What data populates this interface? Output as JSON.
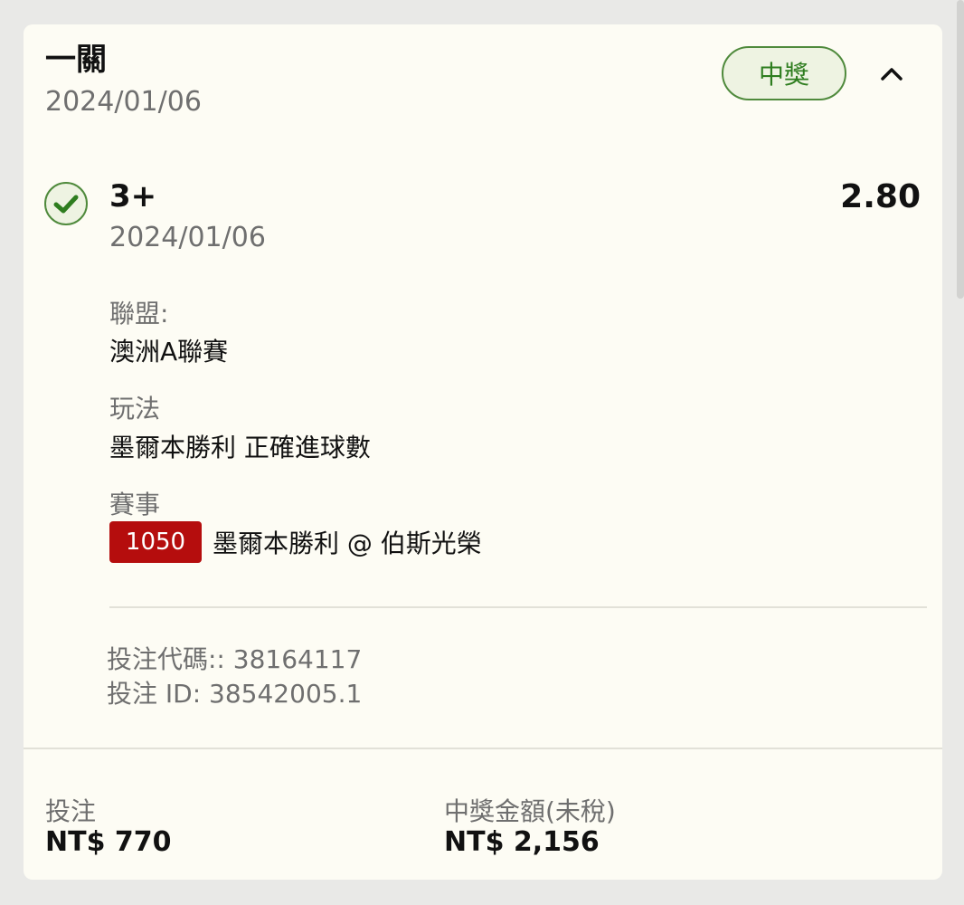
{
  "bet": {
    "type": "一關",
    "date": "2024/01/06",
    "status": "中獎"
  },
  "selection": {
    "name": "3+",
    "date": "2024/01/06",
    "odds": "2.80",
    "league_label": "聯盟:",
    "league": "澳洲A聯賽",
    "play_label": "玩法",
    "play": "墨爾本勝利 正確進球數",
    "event_label": "賽事",
    "event_id": "1050",
    "event": "墨爾本勝利 @ 伯斯光榮"
  },
  "codes": {
    "bet_code": "投注代碼:: 38164117",
    "bet_id": "投注 ID: 38542005.1"
  },
  "footer": {
    "stake_label": "投注",
    "stake": "NT$ 770",
    "payout_label": "中獎金額(未稅)",
    "payout": "NT$ 2,156"
  },
  "colors": {
    "card_bg": "#fdfcf4",
    "page_bg": "#e9e9e7",
    "win_green": "#2e7d1f",
    "event_tag_red": "#b50d0d"
  }
}
